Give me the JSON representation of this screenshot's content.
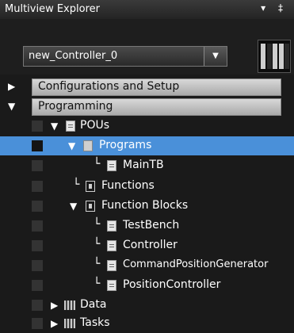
{
  "panel": {
    "title": "Multiview Explorer",
    "pin_glyph": "▾ ‡"
  },
  "controller_select": {
    "value": "new_Controller_0",
    "arrow": "▼"
  },
  "sections": [
    {
      "label": "Configurations and Setup",
      "arrow": "▶"
    },
    {
      "label": "Programming",
      "arrow": "▼"
    }
  ],
  "tree": {
    "pous": "POUs",
    "programs": "Programs",
    "maintb": "MainTB",
    "functions": "Functions",
    "function_blocks": "Function Blocks",
    "testbench": "TestBench",
    "controller": "Controller",
    "commandpos": "CommandPositionGenerator",
    "positionctrl": "PositionController",
    "data": "Data",
    "tasks": "Tasks"
  },
  "glyphs": {
    "expanded": "▼",
    "collapsed": "▶",
    "elbow": "└"
  },
  "colors": {
    "selection": "#4a90d9",
    "section_bar": "#c8c8c8"
  }
}
